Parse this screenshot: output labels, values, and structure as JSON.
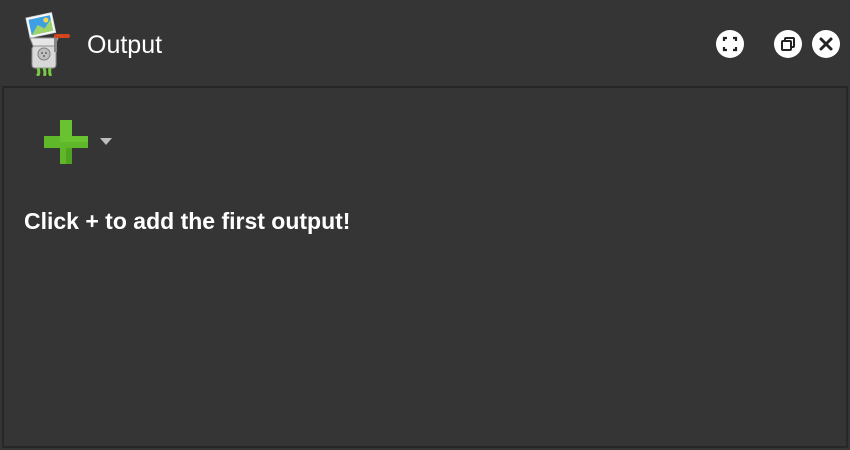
{
  "window": {
    "title": "Output",
    "controls": [
      "fullscreen-icon",
      "restore-icon",
      "close-icon"
    ]
  },
  "app_icon": "meat-grinder-icon",
  "toolbar": {
    "add_icon": "plus-icon",
    "dropdown_icon": "chevron-down-icon"
  },
  "main": {
    "empty_message": "Click + to add the first output!"
  },
  "colors": {
    "background": "#353535",
    "text": "#ffffff",
    "accent_green": "#5fb82a"
  }
}
